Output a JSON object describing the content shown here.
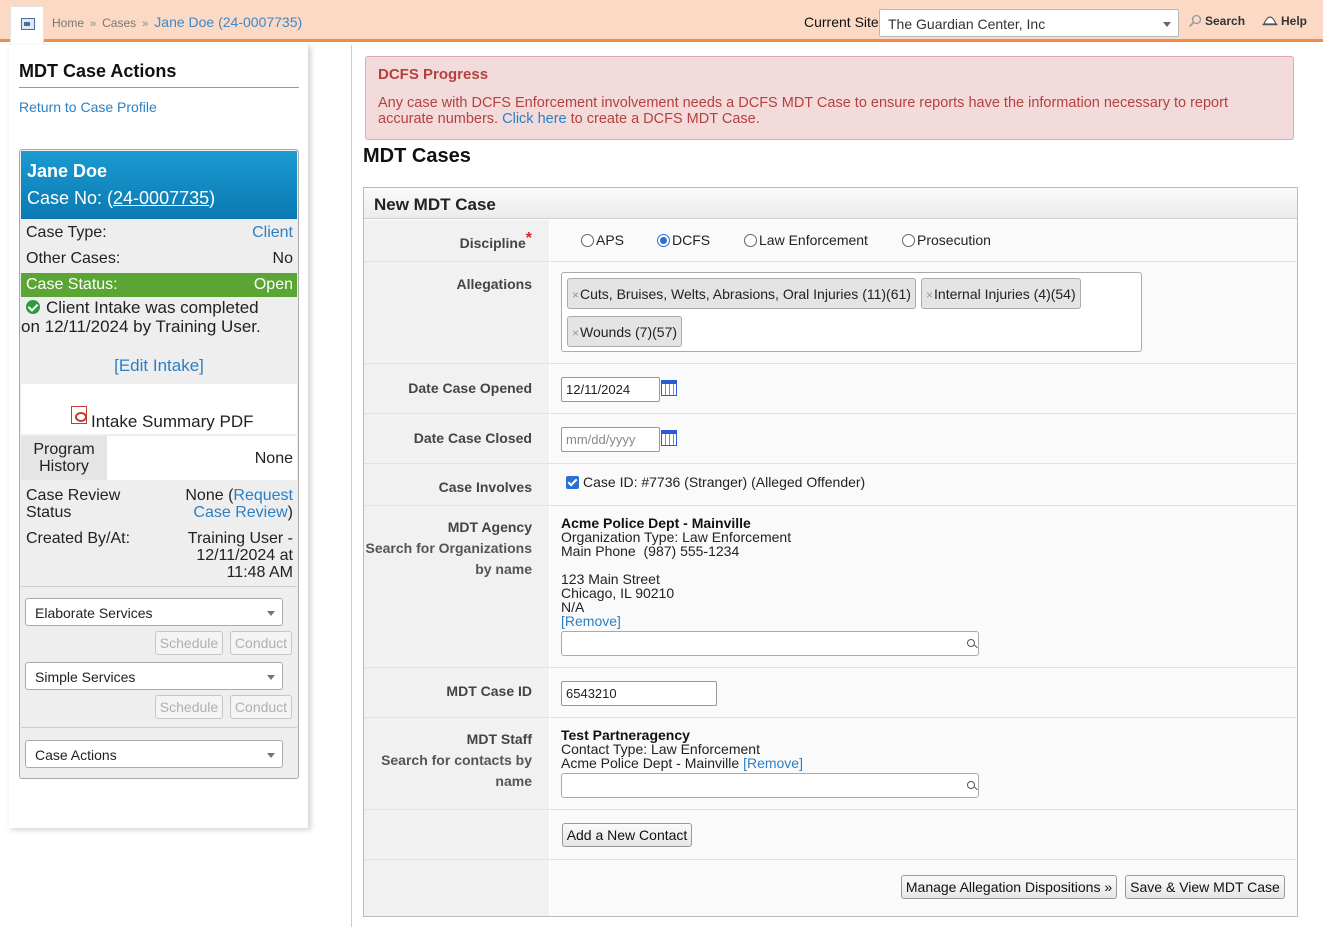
{
  "topbar": {
    "breadcrumbs": [
      "Home",
      "Cases",
      "Jane Doe (24-0007735)"
    ],
    "separator": "»",
    "site_label": "Current Site",
    "site_value": "The Guardian Center, Inc",
    "search_label": "Search",
    "help_label": "Help"
  },
  "sidebar": {
    "title": "MDT Case Actions",
    "return_link": "Return to Case Profile",
    "card": {
      "name": "Jane Doe",
      "case_no_label": "Case No: (",
      "case_no": "24-0007735",
      "case_no_close": ")",
      "case_type_label": "Case Type:",
      "case_type_value": "Client",
      "other_cases_label": "Other Cases:",
      "other_cases_value": "No",
      "status_label": "Case Status:",
      "status_value": "Open",
      "status_color": "#5ba534",
      "intake_line1": "Client Intake was completed",
      "intake_line2": "on 12/11/2024 by Training User.",
      "edit_intake": "[Edit Intake]",
      "pdf_label": "Intake Summary PDF",
      "program_history_label1": "Program",
      "program_history_label2": "History",
      "program_history_value": "None",
      "review_label1": "Case Review",
      "review_label2": "Status",
      "review_none": "None (",
      "review_link1": "Request",
      "review_link2": "Case Review",
      "review_close": ")",
      "created_label": "Created By/At:",
      "created_line1": "Training User -",
      "created_line2": "12/11/2024 at",
      "created_line3": "11:48 AM"
    },
    "services": [
      {
        "name": "Elaborate Services",
        "schedule": "Schedule",
        "conduct": "Conduct"
      },
      {
        "name": "Simple Services",
        "schedule": "Schedule",
        "conduct": "Conduct"
      }
    ],
    "case_actions": "Case Actions"
  },
  "alert": {
    "title": "DCFS Progress",
    "message_part1": "Any case with DCFS Enforcement involvement needs a DCFS MDT Case to ensure reports have the information necessary to report accurate numbers.",
    "link": "Click here",
    "message_part2": "to create a DCFS MDT Case."
  },
  "page": {
    "title": "MDT Cases",
    "form_title": "New MDT Case"
  },
  "form": {
    "discipline_label": "Discipline",
    "required_mark": "*",
    "disciplines": [
      {
        "label": "APS",
        "selected": false
      },
      {
        "label": "DCFS",
        "selected": true
      },
      {
        "label": "Law Enforcement",
        "selected": false
      },
      {
        "label": "Prosecution",
        "selected": false
      }
    ],
    "allegations_label": "Allegations",
    "allegations": [
      "Cuts, Bruises, Welts, Abrasions, Oral Injuries (11)(61)",
      "Internal Injuries (4)(54)",
      "Wounds (7)(57)"
    ],
    "remove_glyph": "×",
    "date_opened_label": "Date Case Opened",
    "date_opened_value": "12/11/2024",
    "date_closed_label": "Date Case Closed",
    "date_closed_placeholder": "mm/dd/yyyy",
    "involves_label": "Case Involves",
    "involves_value": "Case ID: #7736 (Stranger) (Alleged Offender)",
    "agency_label": "MDT Agency",
    "agency_sub1": "Search for Organizations",
    "agency_sub2": "by name",
    "agency": {
      "name": "Acme Police Dept - Mainville",
      "org_type": "Organization Type: Law Enforcement",
      "phone": "Main Phone  (987) 555-1234",
      "street": "123 Main Street",
      "city": "Chicago, IL 90210",
      "extra": "N/A",
      "remove": "[Remove]"
    },
    "mdt_case_id_label": "MDT Case ID",
    "mdt_case_id_value": "6543210",
    "staff_label": "MDT Staff",
    "staff_sub1": "Search for contacts by",
    "staff_sub2": "name",
    "staff": {
      "name": "Test Partneragency",
      "contact_type": "Contact Type: Law Enforcement",
      "org": "Acme Police Dept - Mainville",
      "remove": "[Remove]"
    },
    "add_contact": "Add a New Contact",
    "manage_dispositions": "Manage Allegation Dispositions »",
    "save_view": "Save & View MDT Case"
  }
}
